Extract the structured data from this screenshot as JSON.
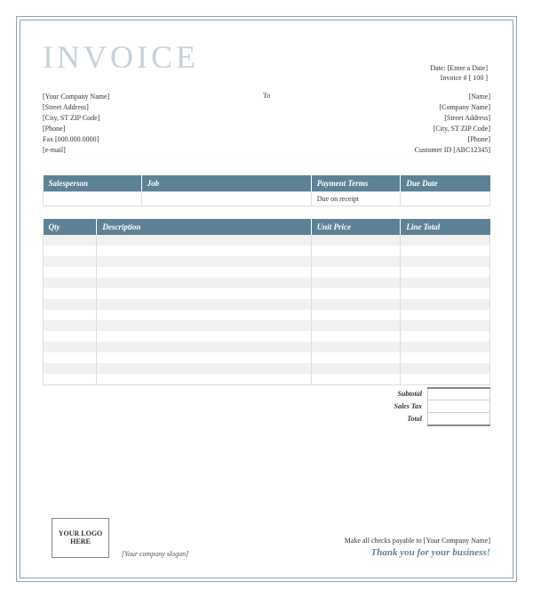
{
  "title": "INVOICE",
  "meta": {
    "date_label": "Date:",
    "date_value": "[Enter a Date]",
    "invoice_num_label": "Invoice #",
    "invoice_num_value": "[ 100 ]"
  },
  "from": {
    "company": "[Your Company Name]",
    "street": "[Street Address]",
    "city": "[City, ST  ZIP Code]",
    "phone": "[Phone]",
    "fax": "Fax [000.000.0000]",
    "email": "[e-mail]"
  },
  "to_label": "To",
  "to": {
    "name": "[Name]",
    "company": "[Company Name]",
    "street": "[Street Address]",
    "city": "[City, ST  ZIP Code]",
    "phone": "[Phone]",
    "customer_id": "Customer ID [ABC12345]"
  },
  "table1": {
    "headers": {
      "salesperson": "Salesperson",
      "job": "Job",
      "payment_terms": "Payment Terms",
      "due_date": "Due Date"
    },
    "row": {
      "salesperson": "",
      "job": "",
      "payment_terms": "Due on receipt",
      "due_date": ""
    }
  },
  "table2": {
    "headers": {
      "qty": "Qty",
      "description": "Description",
      "unit_price": "Unit Price",
      "line_total": "Line Total"
    }
  },
  "totals": {
    "subtotal_label": "Subtotal",
    "salestax_label": "Sales Tax",
    "total_label": "Total",
    "subtotal": "",
    "salestax": "",
    "total": ""
  },
  "footer": {
    "logo_text": "YOUR LOGO HERE",
    "slogan": "[Your company slogan]",
    "payable": "Make all checks payable to [Your Company Name]",
    "thanks": "Thank you for your business!"
  }
}
